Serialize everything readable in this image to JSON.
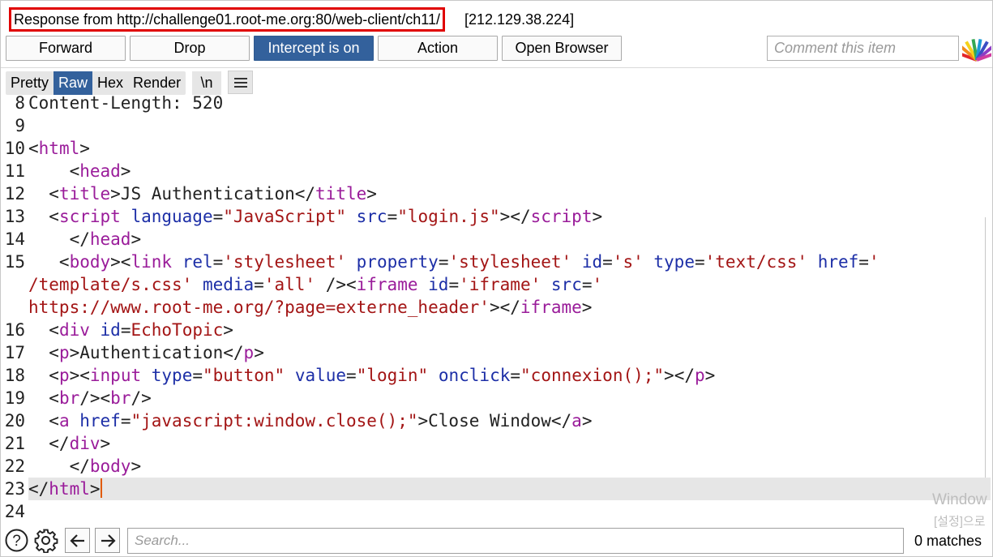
{
  "header": {
    "title": "Response from http://challenge01.root-me.org:80/web-client/ch11/",
    "ip": "[212.129.38.224]"
  },
  "toolbar": {
    "forward": "Forward",
    "drop": "Drop",
    "intercept": "Intercept is on",
    "action": "Action",
    "open_browser": "Open Browser",
    "comment_placeholder": "Comment this item"
  },
  "view_tabs": [
    "Pretty",
    "Raw",
    "Hex",
    "Render"
  ],
  "active_tab": "Raw",
  "newline_toggle": "\\n",
  "editor": {
    "lines": [
      {
        "n": "8",
        "tokens": [
          [
            "t",
            "Content-Length: 520"
          ]
        ]
      },
      {
        "n": "9",
        "tokens": []
      },
      {
        "n": "10",
        "tokens": [
          [
            "t",
            "<"
          ],
          [
            "tg",
            "html"
          ],
          [
            "t",
            ">"
          ]
        ]
      },
      {
        "n": "11",
        "tokens": [
          [
            "t",
            "    <"
          ],
          [
            "tg",
            "head"
          ],
          [
            "t",
            ">"
          ]
        ]
      },
      {
        "n": "12",
        "tokens": [
          [
            "t",
            "  <"
          ],
          [
            "tg",
            "title"
          ],
          [
            "t",
            ">JS Authentication</"
          ],
          [
            "tg",
            "title"
          ],
          [
            "t",
            ">"
          ]
        ]
      },
      {
        "n": "13",
        "tokens": [
          [
            "t",
            "  <"
          ],
          [
            "tg",
            "script"
          ],
          [
            "t",
            " "
          ],
          [
            "at",
            "language"
          ],
          [
            "t",
            "="
          ],
          [
            "av",
            "\"JavaScript\""
          ],
          [
            "t",
            " "
          ],
          [
            "at",
            "src"
          ],
          [
            "t",
            "="
          ],
          [
            "av",
            "\"login.js\""
          ],
          [
            "t",
            "></"
          ],
          [
            "tg",
            "script"
          ],
          [
            "t",
            ">"
          ]
        ]
      },
      {
        "n": "14",
        "tokens": [
          [
            "t",
            "    </"
          ],
          [
            "tg",
            "head"
          ],
          [
            "t",
            ">"
          ]
        ]
      },
      {
        "n": "15",
        "tokens": [
          [
            "t",
            "   <"
          ],
          [
            "tg",
            "body"
          ],
          [
            "t",
            "><"
          ],
          [
            "tg",
            "link"
          ],
          [
            "t",
            " "
          ],
          [
            "at",
            "rel"
          ],
          [
            "t",
            "="
          ],
          [
            "av",
            "'stylesheet'"
          ],
          [
            "t",
            " "
          ],
          [
            "at",
            "property"
          ],
          [
            "t",
            "="
          ],
          [
            "av",
            "'stylesheet'"
          ],
          [
            "t",
            " "
          ],
          [
            "at",
            "id"
          ],
          [
            "t",
            "="
          ],
          [
            "av",
            "'s'"
          ],
          [
            "t",
            " "
          ],
          [
            "at",
            "type"
          ],
          [
            "t",
            "="
          ],
          [
            "av",
            "'text/css'"
          ],
          [
            "t",
            " "
          ],
          [
            "at",
            "href"
          ],
          [
            "t",
            "="
          ],
          [
            "av",
            "'"
          ]
        ]
      },
      {
        "n": "",
        "tokens": [
          [
            "av",
            "/template/s.css'"
          ],
          [
            "t",
            " "
          ],
          [
            "at",
            "media"
          ],
          [
            "t",
            "="
          ],
          [
            "av",
            "'all'"
          ],
          [
            "t",
            " /><"
          ],
          [
            "tg",
            "iframe"
          ],
          [
            "t",
            " "
          ],
          [
            "at",
            "id"
          ],
          [
            "t",
            "="
          ],
          [
            "av",
            "'iframe'"
          ],
          [
            "t",
            " "
          ],
          [
            "at",
            "src"
          ],
          [
            "t",
            "="
          ],
          [
            "av",
            "'"
          ]
        ]
      },
      {
        "n": "",
        "tokens": [
          [
            "av",
            "https://www.root-me.org/?page=externe_header'"
          ],
          [
            "t",
            "></"
          ],
          [
            "tg",
            "iframe"
          ],
          [
            "t",
            ">"
          ]
        ]
      },
      {
        "n": "16",
        "tokens": [
          [
            "t",
            "  <"
          ],
          [
            "tg",
            "div"
          ],
          [
            "t",
            " "
          ],
          [
            "at",
            "id"
          ],
          [
            "t",
            "="
          ],
          [
            "av",
            "EchoTopic"
          ],
          [
            "t",
            ">"
          ]
        ]
      },
      {
        "n": "17",
        "tokens": [
          [
            "t",
            "  <"
          ],
          [
            "tg",
            "p"
          ],
          [
            "t",
            ">Authentication</"
          ],
          [
            "tg",
            "p"
          ],
          [
            "t",
            ">"
          ]
        ]
      },
      {
        "n": "18",
        "tokens": [
          [
            "t",
            "  <"
          ],
          [
            "tg",
            "p"
          ],
          [
            "t",
            "><"
          ],
          [
            "tg",
            "input"
          ],
          [
            "t",
            " "
          ],
          [
            "at",
            "type"
          ],
          [
            "t",
            "="
          ],
          [
            "av",
            "\"button\""
          ],
          [
            "t",
            " "
          ],
          [
            "at",
            "value"
          ],
          [
            "t",
            "="
          ],
          [
            "av",
            "\"login\""
          ],
          [
            "t",
            " "
          ],
          [
            "at",
            "onclick"
          ],
          [
            "t",
            "="
          ],
          [
            "av",
            "\"connexion();\""
          ],
          [
            "t",
            "></"
          ],
          [
            "tg",
            "p"
          ],
          [
            "t",
            ">"
          ]
        ]
      },
      {
        "n": "19",
        "tokens": [
          [
            "t",
            "  <"
          ],
          [
            "tg",
            "br"
          ],
          [
            "t",
            "/><"
          ],
          [
            "tg",
            "br"
          ],
          [
            "t",
            "/>"
          ]
        ]
      },
      {
        "n": "20",
        "tokens": [
          [
            "t",
            "  <"
          ],
          [
            "tg",
            "a"
          ],
          [
            "t",
            " "
          ],
          [
            "at",
            "href"
          ],
          [
            "t",
            "="
          ],
          [
            "av",
            "\"javascript:window.close();\""
          ],
          [
            "t",
            ">Close Window</"
          ],
          [
            "tg",
            "a"
          ],
          [
            "t",
            ">"
          ]
        ]
      },
      {
        "n": "21",
        "tokens": [
          [
            "t",
            "  </"
          ],
          [
            "tg",
            "div"
          ],
          [
            "t",
            ">"
          ]
        ]
      },
      {
        "n": "22",
        "tokens": [
          [
            "t",
            "    </"
          ],
          [
            "tg",
            "body"
          ],
          [
            "t",
            ">"
          ]
        ]
      },
      {
        "n": "23",
        "tokens": [
          [
            "t",
            "</"
          ],
          [
            "tg",
            "html"
          ],
          [
            "t",
            ">"
          ]
        ],
        "current": true
      },
      {
        "n": "24",
        "tokens": []
      }
    ]
  },
  "watermark": {
    "line1": "Window",
    "line2": "[설정]으로"
  },
  "search": {
    "placeholder": "Search...",
    "matches": "0 matches"
  }
}
